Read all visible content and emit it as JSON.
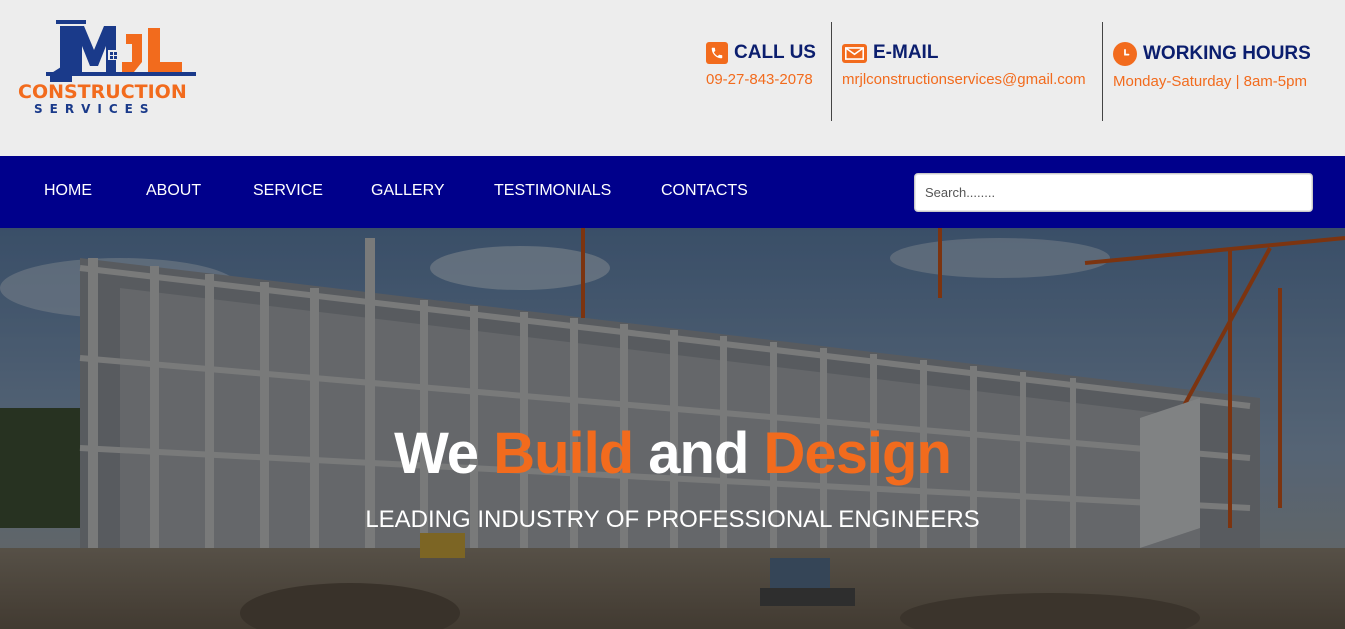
{
  "brand": {
    "logo_mark_text": "MrJL",
    "logo_word": "CONSTRUCTION",
    "logo_sub": "SERVICES",
    "colors": {
      "navy": "#00008b",
      "orange": "#f26b1d",
      "dark_blue_text": "#0b1e6e"
    }
  },
  "contact": {
    "call": {
      "icon": "phone-icon",
      "title": "CALL US",
      "value": "09-27-843-2078"
    },
    "email": {
      "icon": "envelope-icon",
      "title": "E-MAIL",
      "value": "mrjlconstructionservices@gmail.com"
    },
    "hours": {
      "icon": "clock-icon",
      "title": "WORKING HOURS",
      "value": "Monday-Saturday | 8am-5pm"
    }
  },
  "nav": {
    "items": [
      {
        "label": "HOME"
      },
      {
        "label": "ABOUT"
      },
      {
        "label": "SERVICE"
      },
      {
        "label": "GALLERY"
      },
      {
        "label": "TESTIMONIALS"
      },
      {
        "label": "CONTACTS"
      }
    ],
    "search_placeholder": "Search........"
  },
  "hero": {
    "headline": {
      "part1": "We ",
      "part2": "Build",
      "part3": " and ",
      "part4": "Design"
    },
    "subline": "LEADING INDUSTRY OF PROFESSIONAL ENGINEERS"
  }
}
